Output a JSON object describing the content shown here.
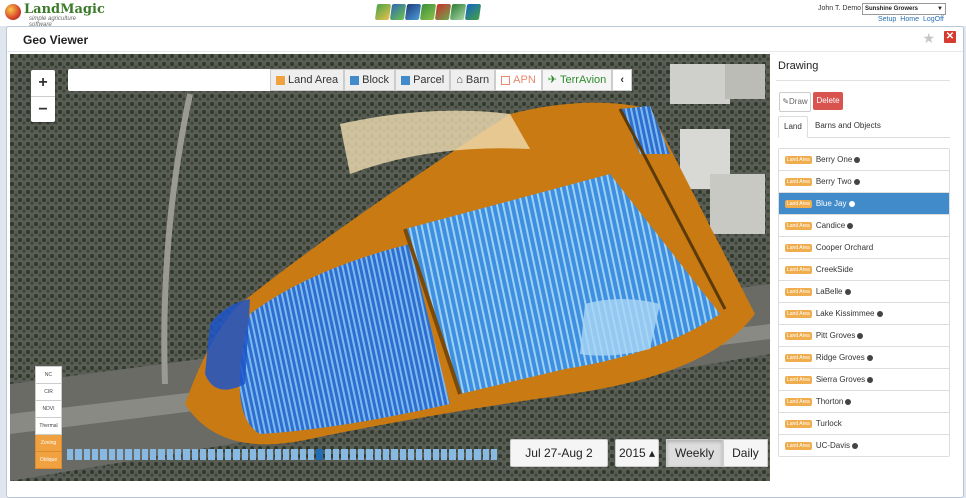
{
  "header": {
    "logo_text": "LandMagic",
    "logo_tagline": "simple agriculture software",
    "app_icons": [
      "app-icon-1",
      "app-icon-2",
      "app-icon-3",
      "app-icon-4",
      "app-icon-5",
      "app-icon-6",
      "app-icon-7"
    ],
    "user_name": "John T. Demo",
    "company": "Sunshine Growers",
    "links": [
      "Setup",
      "Home",
      "LogOff"
    ]
  },
  "window": {
    "title": "Geo Viewer"
  },
  "map": {
    "zoom_in": "+",
    "zoom_out": "−",
    "tools": [
      "Land Area",
      "Block",
      "Parcel",
      "Barn",
      "APN",
      "TerrAvion"
    ],
    "layers": [
      "NC",
      "CIR",
      "NDVI",
      "Thermal",
      "Zoning",
      "Oblique"
    ],
    "active_layers": [
      "Zoning",
      "Oblique"
    ],
    "date_range": "Jul 27-Aug 2",
    "year": "2015 ▴",
    "period_options": [
      "Weekly",
      "Daily"
    ],
    "active_period": "Weekly"
  },
  "panel": {
    "heading": "Drawing",
    "draw_label": "✎Draw",
    "delete_label": "Delete",
    "tabs": [
      "Land",
      "Barns and Objects"
    ],
    "badge_label": "Land Area",
    "items": [
      {
        "name": "Berry One",
        "globe": true
      },
      {
        "name": "Berry Two",
        "globe": true
      },
      {
        "name": "Blue Jay",
        "globe": true,
        "selected": true
      },
      {
        "name": "Candice",
        "globe": true
      },
      {
        "name": "Cooper Orchard",
        "globe": false
      },
      {
        "name": "CreekSide",
        "globe": false
      },
      {
        "name": "LaBelle",
        "globe": true
      },
      {
        "name": "Lake Kissimmee",
        "globe": true
      },
      {
        "name": "Pitt Groves",
        "globe": true
      },
      {
        "name": "Ridge Groves",
        "globe": true
      },
      {
        "name": "Sierra Groves",
        "globe": true
      },
      {
        "name": "Thorton",
        "globe": true
      },
      {
        "name": "Turlock",
        "globe": false
      },
      {
        "name": "UC-Davis",
        "globe": true
      }
    ]
  },
  "colors": {
    "accent": "#428bca",
    "badge": "#f0ad4e",
    "delete": "#d9534f"
  }
}
